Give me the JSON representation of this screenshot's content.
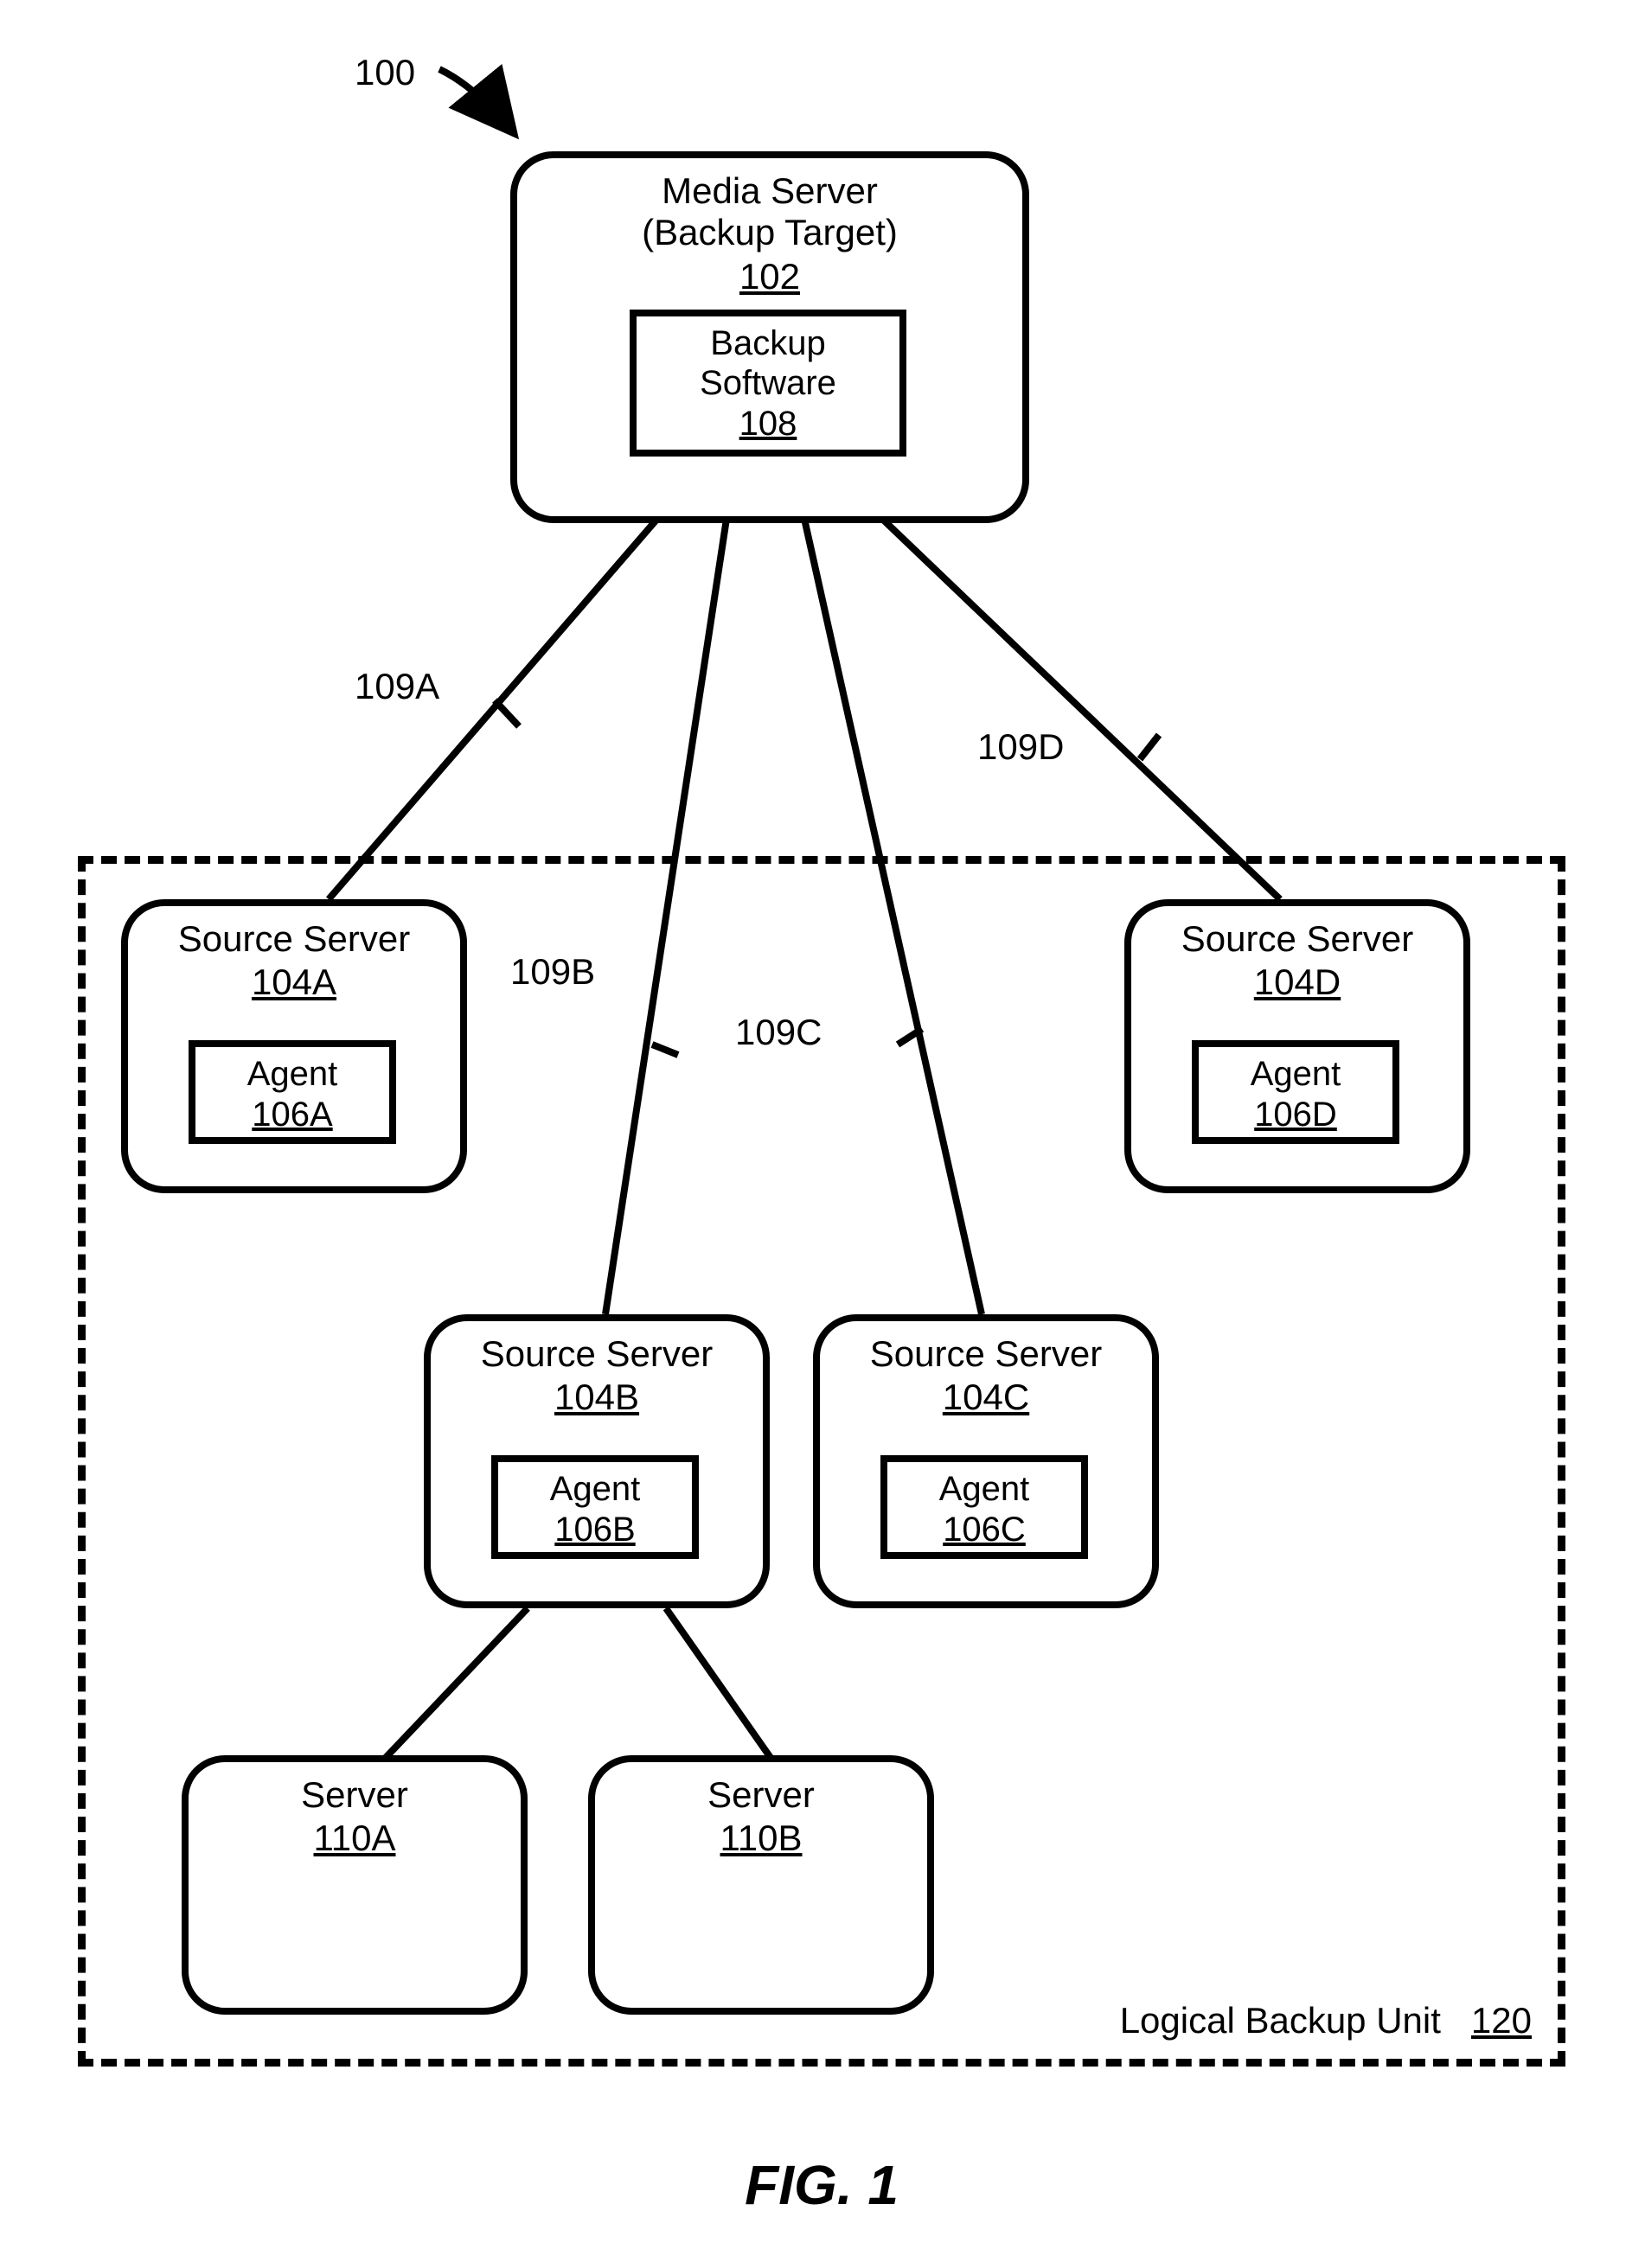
{
  "figure": {
    "number_label": "100",
    "caption": "FIG. 1"
  },
  "media_server": {
    "title_line1": "Media Server",
    "title_line2": "(Backup Target)",
    "ref": "102",
    "inner_title_line1": "Backup",
    "inner_title_line2": "Software",
    "inner_ref": "108"
  },
  "links": {
    "a": "109A",
    "b": "109B",
    "c": "109C",
    "d": "109D"
  },
  "source_servers": {
    "a": {
      "title": "Source Server",
      "ref": "104A",
      "agent_title": "Agent",
      "agent_ref": "106A"
    },
    "b": {
      "title": "Source Server",
      "ref": "104B",
      "agent_title": "Agent",
      "agent_ref": "106B"
    },
    "c": {
      "title": "Source Server",
      "ref": "104C",
      "agent_title": "Agent",
      "agent_ref": "106C"
    },
    "d": {
      "title": "Source Server",
      "ref": "104D",
      "agent_title": "Agent",
      "agent_ref": "106D"
    }
  },
  "servers": {
    "a": {
      "title": "Server",
      "ref": "110A"
    },
    "b": {
      "title": "Server",
      "ref": "110B"
    }
  },
  "lbu": {
    "label_text": "Logical Backup Unit",
    "ref": "120"
  }
}
